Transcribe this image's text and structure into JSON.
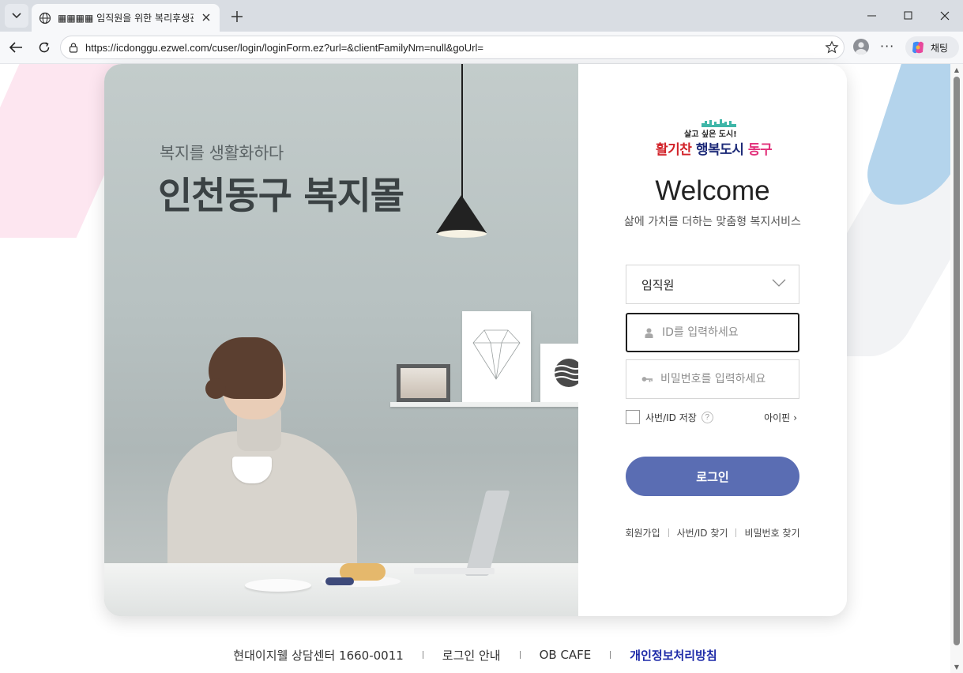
{
  "browser": {
    "tab_title": "▦▦▦▦ 임직원을 위한 복리후생관 ▦▦",
    "url": "https://icdonggu.ezwel.com/cuser/login/loginForm.ez?url=&clientFamilyNm=null&goUrl=",
    "copilot_label": "채팅",
    "more_label": "···"
  },
  "hero": {
    "subtitle": "복지를 생활화하다",
    "title": "인천동구 복지몰"
  },
  "logo": {
    "top": "살고 싶은 도시!",
    "part1": "활기찬",
    "part2": " 행복도시 ",
    "part3": "동구"
  },
  "login": {
    "welcome": "Welcome",
    "tagline": "삶에 가치를 더하는 맞춤형 복지서비스",
    "user_type": "임직원",
    "id_placeholder": "ID를 입력하세요",
    "pw_placeholder": "비밀번호를 입력하세요",
    "remember_label": "사번/ID 저장",
    "help_mark": "?",
    "ipin_label": "아이핀",
    "ipin_chevron": "›",
    "button_label": "로그인",
    "links": [
      "회원가입",
      "사번/ID 찾기",
      "비밀번호 찾기"
    ]
  },
  "footer": {
    "items": [
      "현대이지웰 상담센터 1660-0011",
      "로그인 안내",
      "OB CAFE",
      "개인정보처리방침"
    ]
  },
  "colors": {
    "login_button": "#5a6db3",
    "privacy_link": "#1d2aa8",
    "deco_pink": "#fde6f0",
    "deco_blue": "#b4d4ec"
  }
}
